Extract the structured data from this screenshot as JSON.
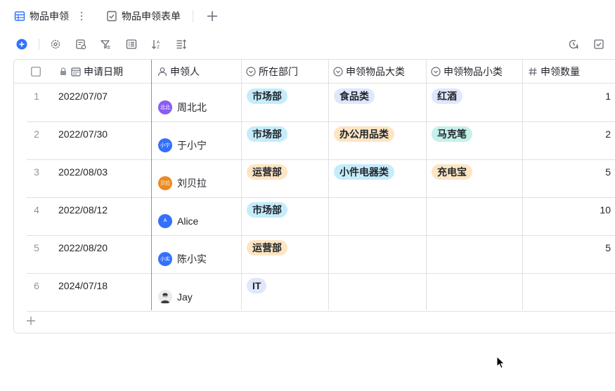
{
  "tabs": [
    {
      "label": "物品申领",
      "icon": "table-icon",
      "active": true
    },
    {
      "label": "物品申领表单",
      "icon": "form-icon",
      "active": false
    }
  ],
  "toolbar": {
    "icons": [
      "add-record-icon",
      "settings-icon",
      "edit-field-icon",
      "filter-icon",
      "group-icon",
      "sort-icon",
      "row-height-icon",
      "history-icon",
      "checklist-icon"
    ]
  },
  "columns": [
    {
      "key": "date",
      "label": "申请日期",
      "icon": "calendar-icon"
    },
    {
      "key": "person",
      "label": "申领人",
      "icon": "person-icon"
    },
    {
      "key": "dept",
      "label": "所在部门",
      "icon": "single-select-icon"
    },
    {
      "key": "category",
      "label": "申领物品大类",
      "icon": "single-select-icon"
    },
    {
      "key": "subcategory",
      "label": "申领物品小类",
      "icon": "single-select-icon"
    },
    {
      "key": "qty",
      "label": "申领数量",
      "icon": "number-icon"
    }
  ],
  "rows": [
    {
      "num": "1",
      "date": "2022/07/07",
      "person": {
        "name": "周北北",
        "avatar_text": "北北",
        "avatar_color": "#8b5cf6"
      },
      "dept": "市场部",
      "category": "食品类",
      "subcategory": "红酒",
      "qty": "1"
    },
    {
      "num": "2",
      "date": "2022/07/30",
      "person": {
        "name": "于小宁",
        "avatar_text": "小宁",
        "avatar_color": "#3370ff"
      },
      "dept": "市场部",
      "category": "办公用品类",
      "subcategory": "马克笔",
      "qty": "2"
    },
    {
      "num": "3",
      "date": "2022/08/03",
      "person": {
        "name": "刘贝拉",
        "avatar_text": "贝拉",
        "avatar_color": "#ed8a1f"
      },
      "dept": "运营部",
      "category": "小件电器类",
      "subcategory": "充电宝",
      "qty": "5"
    },
    {
      "num": "4",
      "date": "2022/08/12",
      "person": {
        "name": "Alice",
        "avatar_text": "A",
        "avatar_color": "#3370ff"
      },
      "dept": "市场部",
      "category": "",
      "subcategory": "",
      "qty": "10"
    },
    {
      "num": "5",
      "date": "2022/08/20",
      "person": {
        "name": "陈小实",
        "avatar_text": "小实",
        "avatar_color": "#3370ff"
      },
      "dept": "运营部",
      "category": "",
      "subcategory": "",
      "qty": "5"
    },
    {
      "num": "6",
      "date": "2024/07/18",
      "person": {
        "name": "Jay",
        "avatar_text": "",
        "avatar_color": "#e8e8e8"
      },
      "dept": "IT",
      "category": "",
      "subcategory": "",
      "qty": ""
    }
  ],
  "tag_colors": {
    "市场部": "#c5ecfa",
    "运营部": "#fde5c4",
    "IT": "#e0e6fb",
    "食品类": "#e0e6fb",
    "办公用品类": "#fde5c4",
    "小件电器类": "#c5ecfa",
    "红酒": "#e0e6fb",
    "马克笔": "#c6f0ea",
    "充电宝": "#fde5c4"
  },
  "colors": {
    "accent": "#3370ff",
    "border": "#dee0e3",
    "icon_gray": "#646a73",
    "muted_text": "#8f959e"
  }
}
